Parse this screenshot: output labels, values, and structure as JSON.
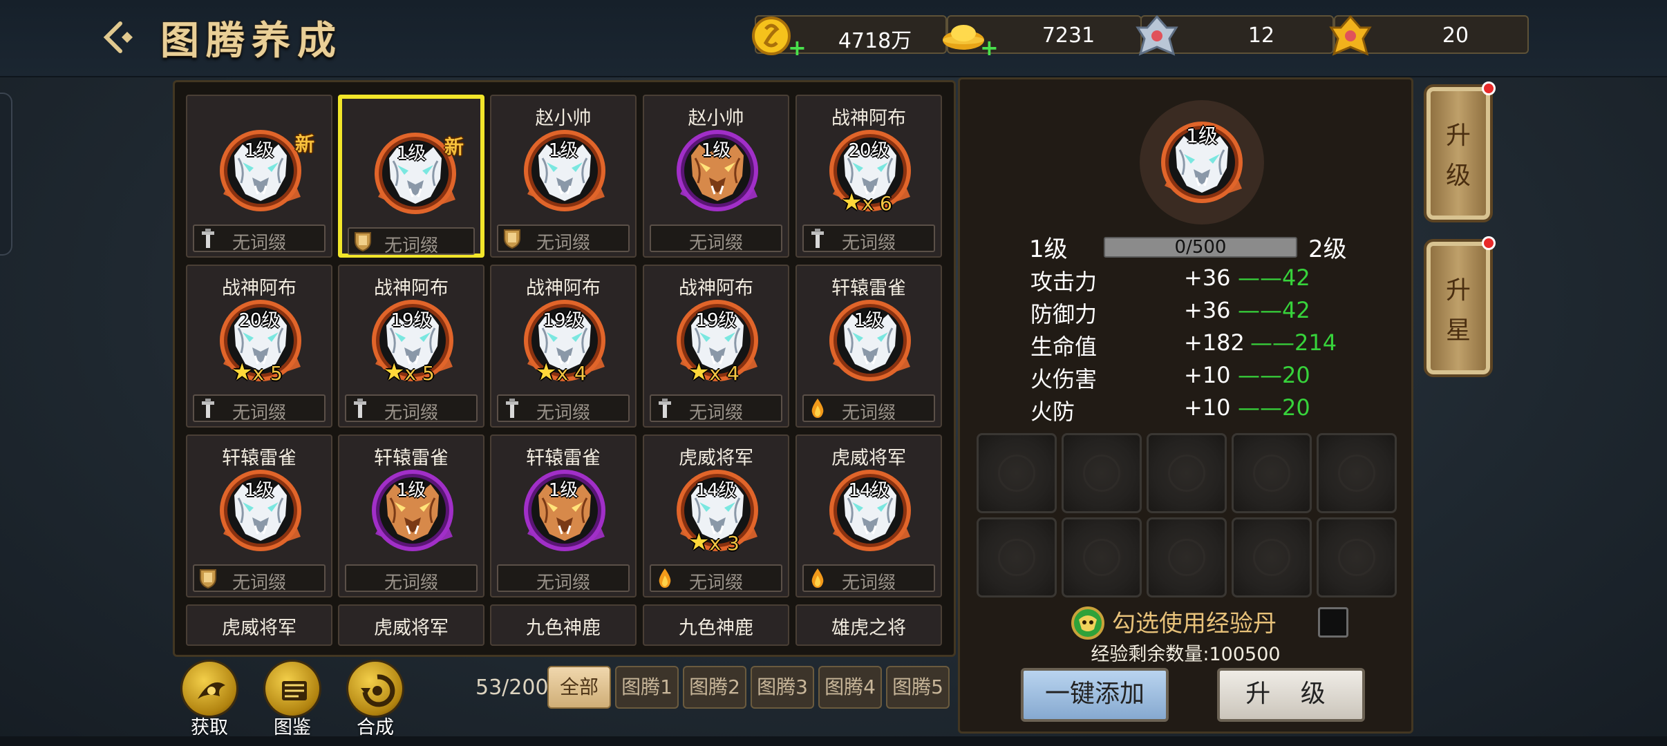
{
  "header": {
    "title": "图腾养成",
    "resources": [
      {
        "name": "gold-coin-icon",
        "value": "4718万",
        "has_plus": true
      },
      {
        "name": "gold-ingot-icon",
        "value": "7231",
        "has_plus": true
      },
      {
        "name": "silver-token-icon",
        "value": "12",
        "has_plus": false
      },
      {
        "name": "gold-token-icon",
        "value": "20",
        "has_plus": false
      }
    ]
  },
  "totems": [
    {
      "name": "",
      "level": "1级",
      "new": "新",
      "stars": "",
      "affix": "无词缀",
      "affix_icon": "sword-icon",
      "frame": "orange",
      "face": "silver",
      "selected": false
    },
    {
      "name": "",
      "level": "1级",
      "new": "新",
      "stars": "",
      "affix": "无词缀",
      "affix_icon": "shield-icon",
      "frame": "orange",
      "face": "silver",
      "selected": true
    },
    {
      "name": "赵小帅",
      "level": "1级",
      "new": "",
      "stars": "",
      "affix": "无词缀",
      "affix_icon": "shield-icon",
      "frame": "orange",
      "face": "silver",
      "selected": false
    },
    {
      "name": "赵小帅",
      "level": "1级",
      "new": "",
      "stars": "",
      "affix": "无词缀",
      "affix_icon": "",
      "frame": "purple",
      "face": "bronze",
      "selected": false
    },
    {
      "name": "战神阿布",
      "level": "20级",
      "new": "",
      "stars": "x 6",
      "affix": "无词缀",
      "affix_icon": "sword-icon",
      "frame": "orange",
      "face": "silver",
      "selected": false
    },
    {
      "name": "战神阿布",
      "level": "20级",
      "new": "",
      "stars": "x 5",
      "affix": "无词缀",
      "affix_icon": "sword-icon",
      "frame": "orange",
      "face": "silver",
      "selected": false
    },
    {
      "name": "战神阿布",
      "level": "19级",
      "new": "",
      "stars": "x 5",
      "affix": "无词缀",
      "affix_icon": "sword-icon",
      "frame": "orange",
      "face": "silver",
      "selected": false
    },
    {
      "name": "战神阿布",
      "level": "19级",
      "new": "",
      "stars": "x 4",
      "affix": "无词缀",
      "affix_icon": "sword-icon",
      "frame": "orange",
      "face": "silver",
      "selected": false
    },
    {
      "name": "战神阿布",
      "level": "19级",
      "new": "",
      "stars": "x 4",
      "affix": "无词缀",
      "affix_icon": "sword-icon",
      "frame": "orange",
      "face": "silver",
      "selected": false
    },
    {
      "name": "轩辕雷雀",
      "level": "1级",
      "new": "",
      "stars": "",
      "affix": "无词缀",
      "affix_icon": "fire-drop-icon",
      "frame": "orange",
      "face": "silver",
      "selected": false
    },
    {
      "name": "轩辕雷雀",
      "level": "1级",
      "new": "",
      "stars": "",
      "affix": "无词缀",
      "affix_icon": "shield-icon",
      "frame": "orange",
      "face": "silver",
      "selected": false
    },
    {
      "name": "轩辕雷雀",
      "level": "1级",
      "new": "",
      "stars": "",
      "affix": "无词缀",
      "affix_icon": "",
      "frame": "purple",
      "face": "bronze",
      "selected": false
    },
    {
      "name": "轩辕雷雀",
      "level": "1级",
      "new": "",
      "stars": "",
      "affix": "无词缀",
      "affix_icon": "",
      "frame": "purple",
      "face": "bronze",
      "selected": false
    },
    {
      "name": "虎威将军",
      "level": "14级",
      "new": "",
      "stars": "x 3",
      "affix": "无词缀",
      "affix_icon": "fire-drop-icon",
      "frame": "orange",
      "face": "silver",
      "selected": false
    },
    {
      "name": "虎威将军",
      "level": "14级",
      "new": "",
      "stars": "",
      "affix": "无词缀",
      "affix_icon": "fire-drop-icon",
      "frame": "orange",
      "face": "silver",
      "selected": false
    }
  ],
  "partial_row": [
    "虎威将军",
    "虎威将军",
    "九色神鹿",
    "九色神鹿",
    "雄虎之将"
  ],
  "actions": [
    {
      "label": "获取",
      "icon": "obtain-icon"
    },
    {
      "label": "图鉴",
      "icon": "handbook-icon"
    },
    {
      "label": "合成",
      "icon": "synthesize-icon"
    }
  ],
  "inventory_count": "53/200",
  "tabs": [
    "全部",
    "图腾1",
    "图腾2",
    "图腾3",
    "图腾4",
    "图腾5"
  ],
  "active_tab": 0,
  "detail": {
    "level": "1级",
    "level_current": "1级",
    "level_next": "2级",
    "exp_text": "0/500",
    "exp_fraction": 0,
    "stats": [
      {
        "name": "攻击力",
        "value": "+36",
        "next": "——42"
      },
      {
        "name": "防御力",
        "value": "+36",
        "next": "——42"
      },
      {
        "name": "生命值",
        "value": "+182",
        "next": "——214"
      },
      {
        "name": "火伤害",
        "value": "+10",
        "next": "——20"
      },
      {
        "name": "火防",
        "value": "+10",
        "next": "——20"
      }
    ],
    "use_exp_label": "勾选使用经验丹",
    "exp_left": "经验剩余数量:100500",
    "btn_add": "一键添加",
    "btn_upgrade": "升 级"
  },
  "side_tabs": [
    "升级",
    "升星"
  ],
  "colors": {
    "gold": "#e9cf97",
    "green": "#37d33b",
    "select": "#f2e62a",
    "orange_frame": "#e1652a",
    "purple_frame": "#a12fc8"
  }
}
